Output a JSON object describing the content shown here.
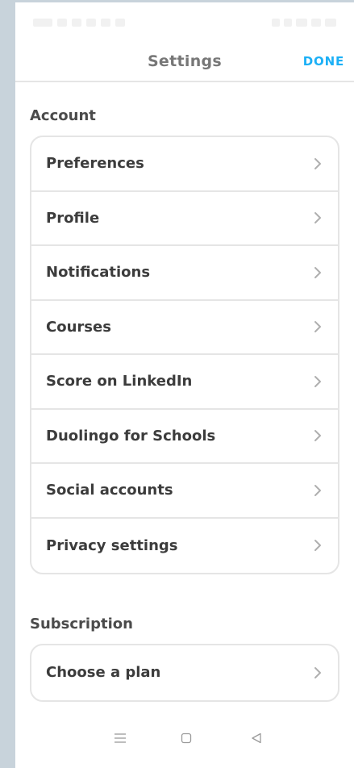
{
  "header": {
    "title": "Settings",
    "done_label": "DONE"
  },
  "account": {
    "title": "Account",
    "items": [
      {
        "label": "Preferences"
      },
      {
        "label": "Profile"
      },
      {
        "label": "Notifications"
      },
      {
        "label": "Courses"
      },
      {
        "label": "Score on LinkedIn"
      },
      {
        "label": "Duolingo for Schools"
      },
      {
        "label": "Social accounts"
      },
      {
        "label": "Privacy settings"
      }
    ]
  },
  "subscription": {
    "title": "Subscription",
    "items": [
      {
        "label": "Choose a plan"
      }
    ]
  },
  "nav": {
    "menu_icon": "menu-icon",
    "home_icon": "home-square-icon",
    "back_icon": "back-triangle-icon"
  },
  "colors": {
    "accent": "#1cb0f6",
    "divider": "#e5e5e5",
    "text": "#3c3c3c",
    "backdrop": "#c8d3db"
  }
}
